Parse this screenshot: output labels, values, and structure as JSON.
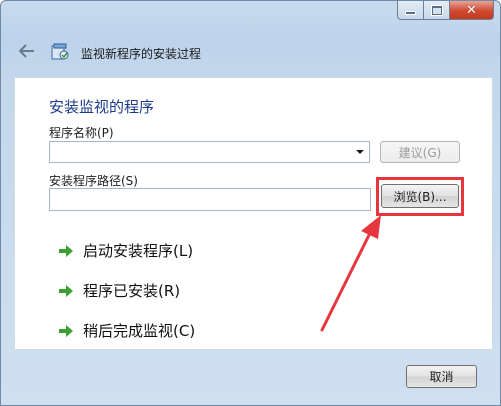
{
  "window": {
    "title": "监视新程序的安装过程",
    "caption": {
      "minimize_icon": "minimize-icon",
      "maximize_icon": "maximize-icon",
      "close_glyph": "✕"
    }
  },
  "form": {
    "section_title": "安装监视的程序",
    "program_name_label": "程序名称(P)",
    "program_name_value": "",
    "suggest_button": "建议(G)",
    "install_path_label": "安装程序路径(S)",
    "install_path_value": "",
    "browse_button": "浏览(B)..."
  },
  "commands": [
    {
      "label": "启动安装程序(L)"
    },
    {
      "label": "程序已安装(R)"
    },
    {
      "label": "稍后完成监视(C)"
    }
  ],
  "footer": {
    "cancel_button": "取消"
  },
  "colors": {
    "accent": "#1e3b8a",
    "arrow_green": "#3aa032",
    "annotation_red": "#e8363f"
  }
}
